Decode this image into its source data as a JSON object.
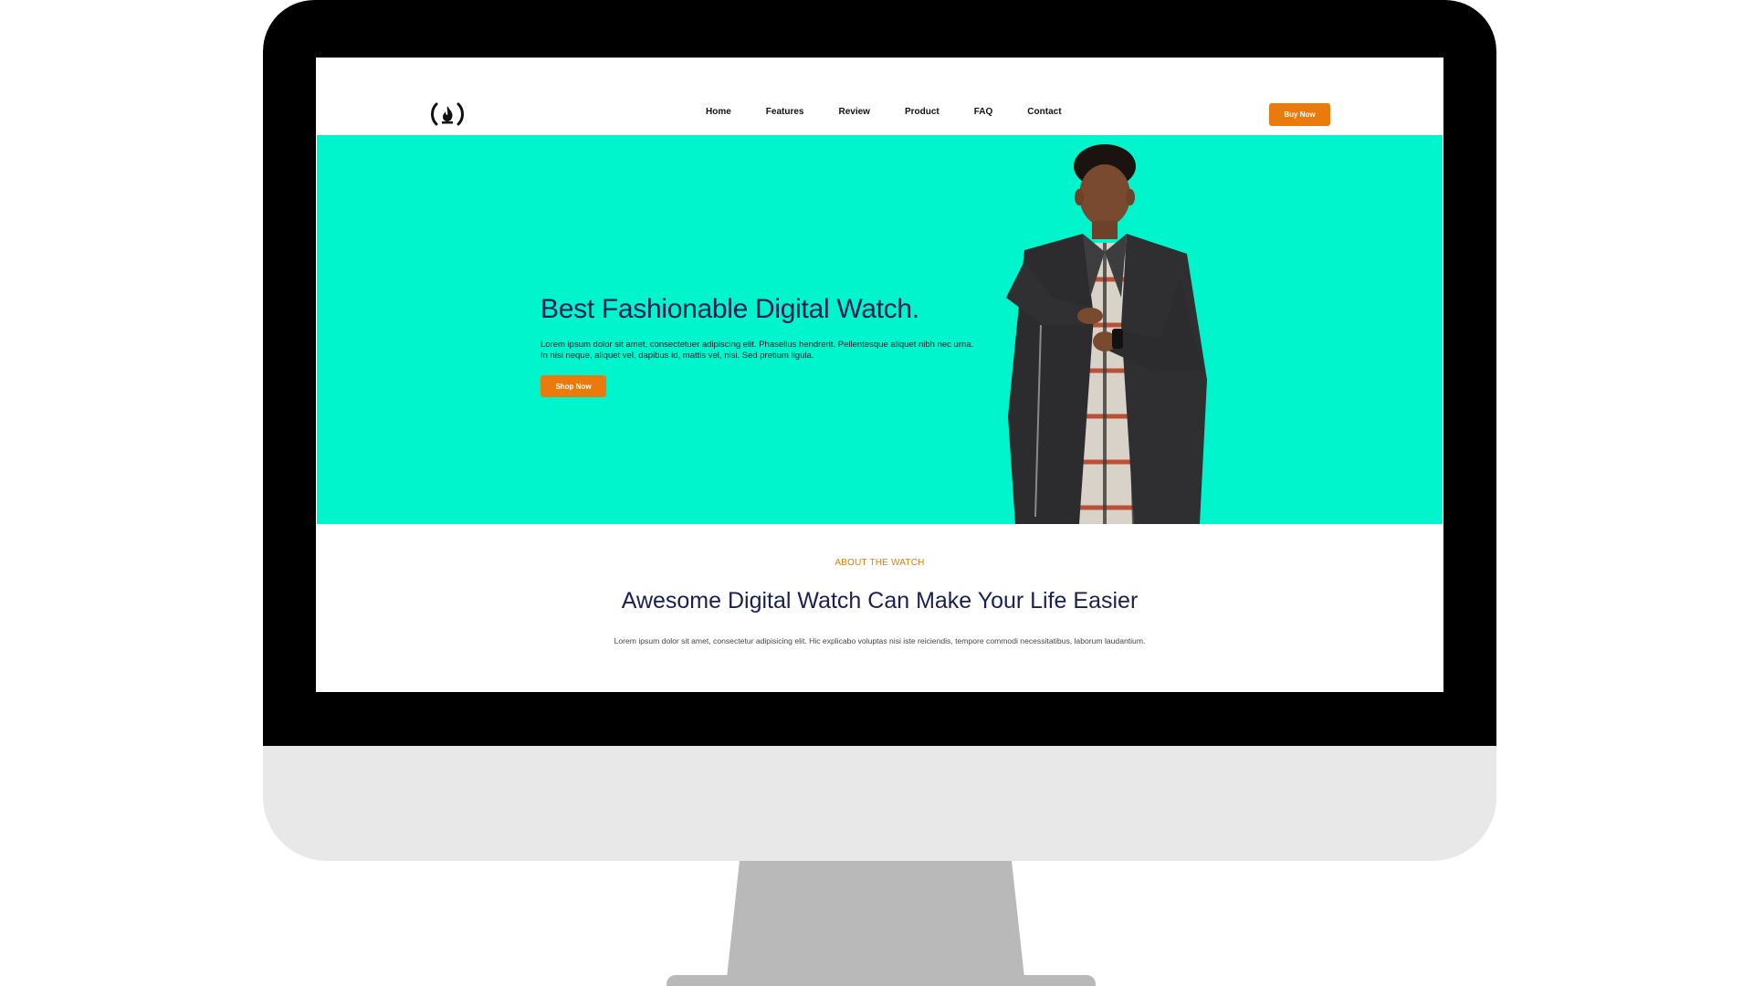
{
  "nav": {
    "logo_glyph": "(🔥)",
    "links": [
      "Home",
      "Features",
      "Review",
      "Product",
      "FAQ",
      "Contact"
    ],
    "buy_label": "Buy Now"
  },
  "hero": {
    "title": "Best Fashionable Digital Watch.",
    "description": "Lorem ipsum dolor sit amet, consectetuer adipiscing elit. Phasellus hendrerit. Pellentesque aliquet nibh nec urna. In nisi neque, aliquet vel, dapibus id, mattis vel, nisi. Sed pretium ligula.",
    "cta_label": "Shop Now",
    "background_color": "#00f5cc"
  },
  "about": {
    "eyebrow": "ABOUT THE WATCH",
    "title": "Awesome Digital Watch Can Make Your Life Easier",
    "description": "Lorem ipsum dolor sit amet, consectetur adipisicing elit. Hic explicabo voluptas nisi iste reiciendis, tempore commodi necessitatibus, laborum laudantium."
  },
  "colors": {
    "accent": "#ea7a0c",
    "heading": "#1c1f55",
    "hero_bg": "#00f5cc"
  },
  "icons": {
    "logo": "freecodecamp-flame-icon"
  }
}
